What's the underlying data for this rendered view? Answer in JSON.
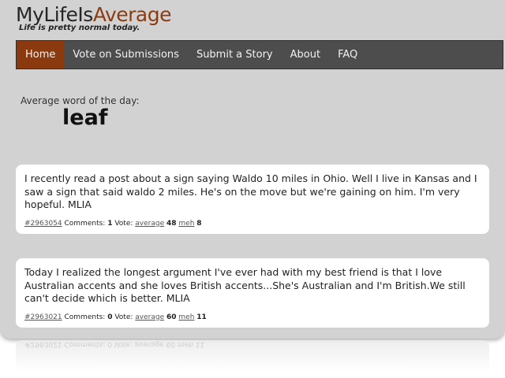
{
  "header": {
    "logo_part1": "MyLifeIs",
    "logo_part2": "Average",
    "tagline": "Life is pretty normal today."
  },
  "nav": {
    "items": [
      {
        "label": "Home",
        "active": true
      },
      {
        "label": "Vote on Submissions"
      },
      {
        "label": "Submit a Story"
      },
      {
        "label": "About"
      },
      {
        "label": "FAQ"
      }
    ]
  },
  "word_of_day": {
    "label": "Average word of the day:",
    "word": "leaf"
  },
  "stories": [
    {
      "text": "I recently read a post about a sign saying Waldo 10 miles in Ohio. Well I live in Kansas and I saw a sign that said waldo 2 miles. He's on the move but we're gaining on him. I'm very hopeful. MLIA",
      "id": "#2963054",
      "comments_label": "Comments:",
      "comments": "1",
      "vote_label": "Vote:",
      "average_label": "average",
      "average_count": "48",
      "meh_label": "meh",
      "meh_count": "8"
    },
    {
      "text": "Today I realized the longest argument I've ever had with my best friend is that I love Australian accents and she loves British accents...She's Australian and I'm British.We still can't decide which is better. MLIA",
      "id": "#2963021",
      "comments_label": "Comments:",
      "comments": "0",
      "vote_label": "Vote:",
      "average_label": "average",
      "average_count": "60",
      "meh_label": "meh",
      "meh_count": "11"
    }
  ],
  "colors": {
    "background": "#d2d2d2",
    "nav_bg": "#4d4d4d",
    "nav_active": "#8b3a0f",
    "logo_accent": "#8a3d12"
  }
}
